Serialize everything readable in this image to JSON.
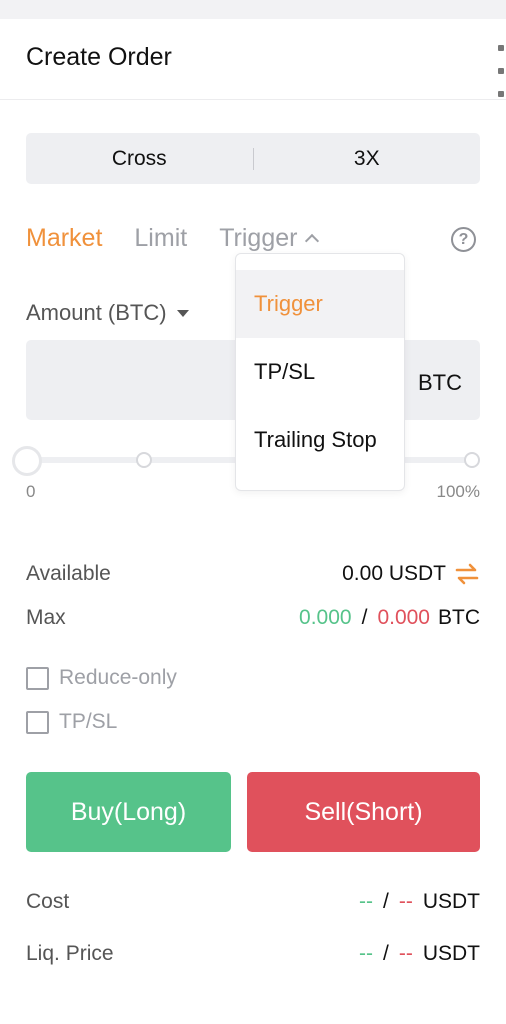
{
  "header": {
    "title": "Create Order"
  },
  "margin": {
    "mode": "Cross",
    "leverage": "3X"
  },
  "order_tabs": [
    {
      "label": "Market",
      "active": true
    },
    {
      "label": "Limit",
      "active": false
    },
    {
      "label": "Trigger",
      "active": false
    }
  ],
  "amount": {
    "label": "Amount (BTC)",
    "unit": "BTC",
    "value": "",
    "placeholder": ""
  },
  "slider": {
    "min_label": "0",
    "max_label": "100%",
    "value_percent": 0
  },
  "dropdown": {
    "items": [
      {
        "label": "Trigger",
        "selected": true
      },
      {
        "label": "TP/SL",
        "selected": false
      },
      {
        "label": "Trailing Stop",
        "selected": false
      }
    ]
  },
  "available": {
    "label": "Available",
    "value": "0.00 USDT"
  },
  "max": {
    "label": "Max",
    "long": "0.000",
    "sep": "/",
    "short": "0.000",
    "unit": "BTC"
  },
  "options": {
    "reduce_only": "Reduce-only",
    "tpsl": "TP/SL"
  },
  "buttons": {
    "buy": "Buy(Long)",
    "sell": "Sell(Short)"
  },
  "cost": {
    "label": "Cost",
    "long": "--",
    "sep": "/",
    "short": "--",
    "unit": "USDT"
  },
  "liq": {
    "label": "Liq. Price",
    "long": "--",
    "sep": "/",
    "short": "--",
    "unit": "USDT"
  },
  "colors": {
    "accent": "#f0913b",
    "buy": "#56c38a",
    "sell": "#e0515c"
  }
}
